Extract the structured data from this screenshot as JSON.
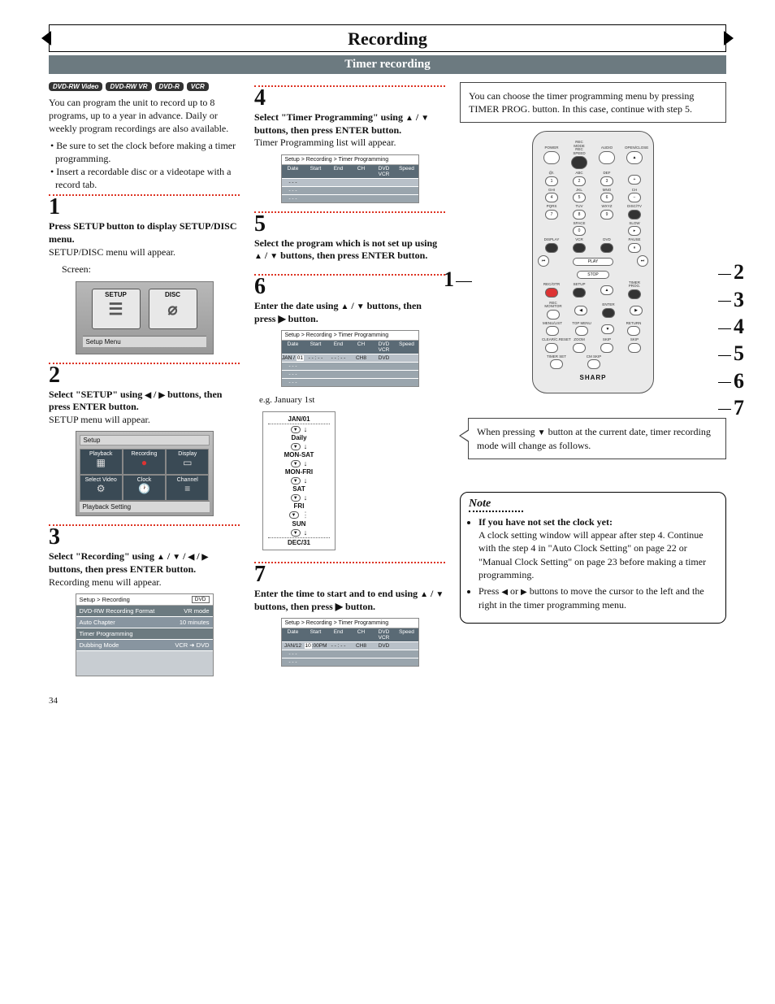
{
  "page_title": "Recording",
  "sub_header": "Timer recording",
  "badges": [
    "DVD-RW Video",
    "DVD-RW VR",
    "DVD-R",
    "VCR"
  ],
  "intro_text": "You can program the unit to record up to 8 programs, up to a year in advance. Daily or weekly program recordings are also available.",
  "intro_bullets": [
    "• Be sure to set the clock before making a timer programming.",
    "• Insert a recordable disc or a videotape with a record tab."
  ],
  "steps": {
    "s1": {
      "num": "1",
      "title": "Press SETUP button to display SETUP/DISC menu.",
      "body": "SETUP/DISC menu will appear.",
      "body2": "Screen:",
      "screen": {
        "card1": "SETUP",
        "card2": "DISC",
        "caption": "Setup Menu"
      }
    },
    "s2": {
      "num": "2",
      "title_pre": "Select \"SETUP\" using ",
      "title_mid": " / ",
      "title_post": " buttons, then press ENTER button.",
      "body": "SETUP menu will appear.",
      "screen": {
        "top": "Setup",
        "cells": [
          "Playback",
          "Recording",
          "Display",
          "Select Video",
          "Clock",
          "Channel"
        ],
        "caption": "Playback Setting"
      }
    },
    "s3": {
      "num": "3",
      "title_pre": "Select \"Recording\" using ",
      "title_post": " buttons, then press ENTER button.",
      "body": "Recording menu will appear.",
      "screen": {
        "top": "Setup > Recording",
        "dvd": "DVD",
        "rows": [
          [
            "DVD-RW Recording Format",
            "VR mode"
          ],
          [
            "Auto Chapter",
            "10 minutes"
          ],
          [
            "Timer Programming",
            ""
          ],
          [
            "Dubbing Mode",
            "VCR ➜ DVD"
          ]
        ]
      }
    },
    "s4": {
      "num": "4",
      "title_pre": "Select \"Timer Programming\" using ",
      "title_post": " buttons, then press ENTER button.",
      "body": "Timer Programming list will appear.",
      "screen": {
        "top": "Setup > Recording > Timer Programming",
        "cols": [
          "Date",
          "Start",
          "End",
          "CH",
          "DVD VCR",
          "Speed"
        ],
        "rows": [
          "- - -",
          "- - -",
          "- - -"
        ]
      }
    },
    "s5": {
      "num": "5",
      "title_pre": "Select the program which is not set up using ",
      "title_post": " buttons, then press ENTER button."
    },
    "s6": {
      "num": "6",
      "title_pre": "Enter the date using ",
      "title_post": " buttons, then press ▶ button.",
      "screen": {
        "top": "Setup > Recording > Timer Programming",
        "cols": [
          "Date",
          "Start",
          "End",
          "CH",
          "DVD VCR",
          "Speed"
        ],
        "row1": [
          "JAN / 01",
          "- - : - -",
          "- - : - -",
          "CH8",
          "DVD",
          ""
        ],
        "rows": [
          "- - -",
          "- - -",
          "- - -"
        ]
      },
      "eg": "e.g. January 1st",
      "flow": [
        "JAN/01",
        "Daily",
        "MON-SAT",
        "MON-FRI",
        "SAT",
        "FRI",
        "SUN",
        "DEC/31"
      ],
      "callout_pre": "When pressing ",
      "callout_post": " button at the current date, timer recording mode will change as follows."
    },
    "s7": {
      "num": "7",
      "title_pre": "Enter the time to start and to end using ",
      "title_post": " buttons, then press ▶ button.",
      "screen": {
        "top": "Setup > Recording > Timer Programming",
        "cols": [
          "Date",
          "Start",
          "End",
          "CH",
          "DVD VCR",
          "Speed"
        ],
        "row1": [
          "JAN/12",
          "10:00PM",
          "- - : - -",
          "CH8",
          "DVD",
          ""
        ],
        "rows": [
          "- - -",
          "- - -"
        ]
      }
    }
  },
  "col3_top": "You can choose the timer programming menu by pressing TIMER PROG. button. In this case, continue with step 5.",
  "remote": {
    "labels_row1": [
      "POWER",
      "REC MODE REC SPEED",
      "AUDIO",
      "OPEN/CLOSE"
    ],
    "labels_num": [
      "@!.",
      "ABC",
      "DEF",
      "",
      "GHI",
      "JKL",
      "MNO",
      "CH",
      "PQRS",
      "TUV",
      "WXYZ",
      "DISC/TV"
    ],
    "space": "SPACE",
    "slow": "SLOW",
    "display": "DISPLAY",
    "vcr": "VCR",
    "dvd": "DVD",
    "pause": "PAUSE",
    "play": "PLAY",
    "stop": "STOP",
    "rec": "REC/OTR",
    "setup": "SETUP",
    "timerprog": "TIMER PROG.",
    "recmon": "REC MONITOR",
    "enter": "ENTER",
    "menulist": "MENU/LIST",
    "topmenu": "TOP MENU",
    "return": "RETURN",
    "clear": "CLEAR/C.RESET",
    "zoom": "ZOOM",
    "skip1": "SKIP",
    "skip2": "SKIP",
    "timerset": "TIMER SET",
    "cmskip": "CM SKIP",
    "brand": "SHARP"
  },
  "right_nums": [
    "2",
    "3",
    "4",
    "5",
    "6",
    "7"
  ],
  "left_num": "1",
  "note": {
    "title": "Note",
    "b1_title": "If you have not set the clock yet:",
    "b1_body": "A clock setting window will appear after step 4.  Continue with the step 4 in \"Auto Clock Setting\" on page 22 or \"Manual Clock Setting\" on page 23 before making a timer programming.",
    "b2_pre": "Press ",
    "b2_post": " buttons to move the cursor to the left and the right in the timer programming menu."
  },
  "page_number": "34"
}
